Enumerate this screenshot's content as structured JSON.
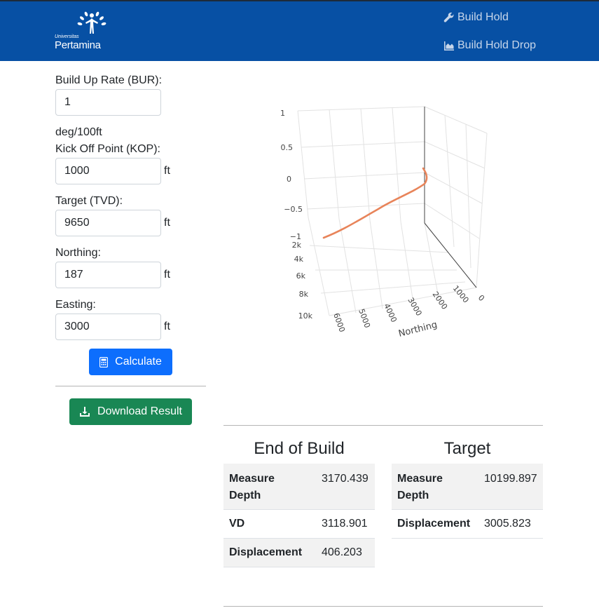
{
  "brand": {
    "line1": "Universitas",
    "line2": "Pertamina"
  },
  "nav": {
    "build_hold": "Build Hold",
    "build_hold_drop": "Build Hold Drop"
  },
  "form": {
    "bur": {
      "label": "Build Up Rate (BUR):",
      "value": "1",
      "unit": "deg/100ft"
    },
    "kop": {
      "label": "Kick Off Point (KOP):",
      "value": "1000",
      "unit": "ft"
    },
    "tvd": {
      "label": "Target (TVD):",
      "value": "9650",
      "unit": "ft"
    },
    "northing": {
      "label": "Northing:",
      "value": "187",
      "unit": "ft"
    },
    "easting": {
      "label": "Easting:",
      "value": "3000",
      "unit": "ft"
    },
    "calculate": "Calculate",
    "download": "Download Result"
  },
  "plot": {
    "z_ticks": [
      "1",
      "0.5",
      "0",
      "−0.5",
      "−1"
    ],
    "depth_ticks": [
      "2k",
      "4k",
      "6k",
      "8k",
      "10k"
    ],
    "easting_ticks": [
      "6000",
      "5000",
      "4000",
      "3000",
      "2000",
      "1000",
      "0"
    ],
    "axis_title": "Northing",
    "line_color": "#e8845a"
  },
  "end_of_build": {
    "title": "End of Build",
    "rows": [
      {
        "key": "Measure Depth",
        "value": "3170.439"
      },
      {
        "key": "VD",
        "value": "3118.901"
      },
      {
        "key": "Displacement",
        "value": "406.203"
      }
    ]
  },
  "target": {
    "title": "Target",
    "rows": [
      {
        "key": "Measure Depth",
        "value": "10199.897"
      },
      {
        "key": "Displacement",
        "value": "3005.823"
      }
    ]
  }
}
